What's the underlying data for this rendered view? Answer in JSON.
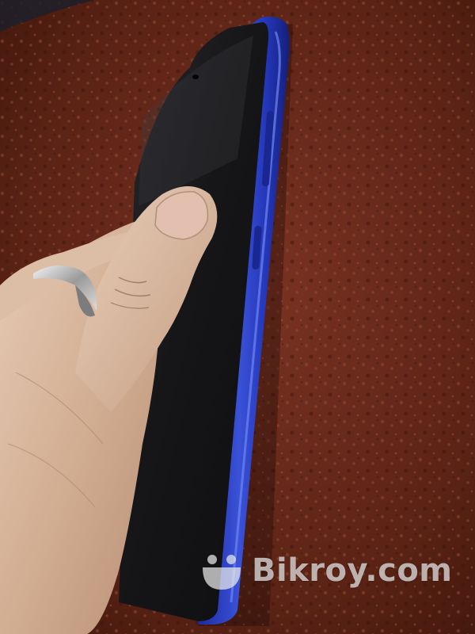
{
  "watermark": {
    "text": "Bikroy.com",
    "icon": "bikroy-smile-logo-icon"
  },
  "colors": {
    "background_table": "#6a2a1c",
    "phone_frame": "#2a3fb8",
    "phone_screen": "#151515",
    "skin": "#d8b79e",
    "watermark": "#ebebeb"
  },
  "scene": {
    "subject": "blue-smartphone-held-in-hand",
    "accessory": "silver-ring"
  }
}
